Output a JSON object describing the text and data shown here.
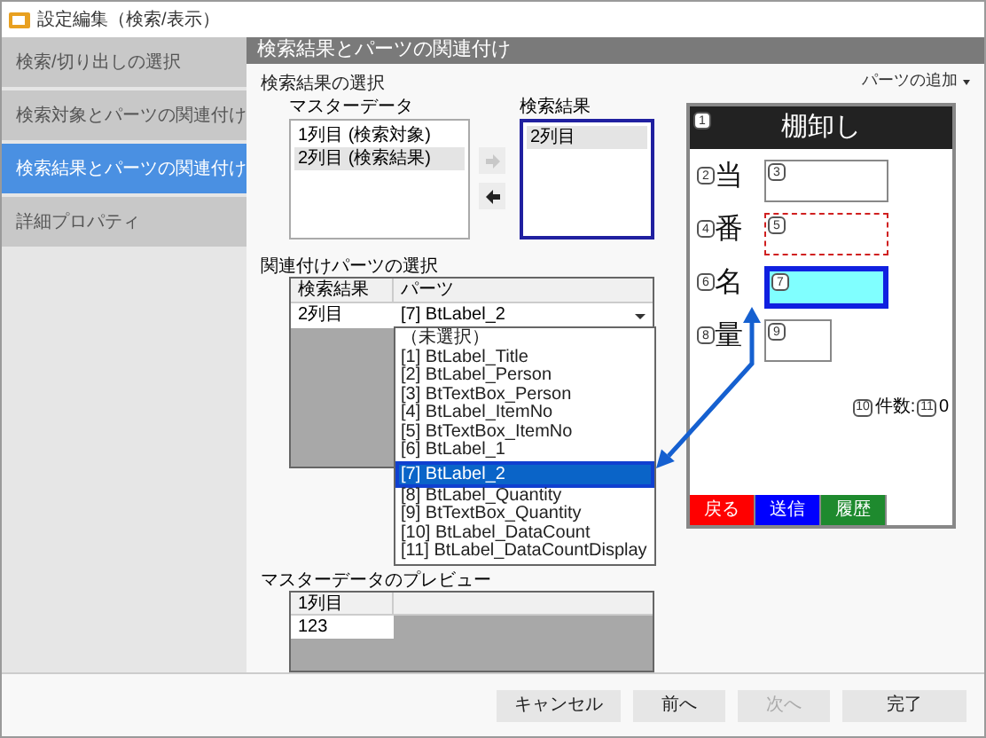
{
  "window": {
    "title": "設定編集（検索/表示）"
  },
  "sidebar": {
    "items": [
      {
        "label": "検索/切り出しの選択",
        "selected": false
      },
      {
        "label": "検索対象とパーツの関連付け",
        "selected": false
      },
      {
        "label": "検索結果とパーツの関連付け",
        "selected": true
      },
      {
        "label": "詳細プロパティ",
        "selected": false
      }
    ]
  },
  "page_title": "検索結果とパーツの関連付け",
  "result_selection": {
    "title": "検索結果の選択",
    "master": {
      "label": "マスターデータ",
      "items": [
        {
          "label": "1列目 (検索対象)",
          "selected": false
        },
        {
          "label": "2列目 (検索結果)",
          "selected": true
        }
      ]
    },
    "move_buttons": [
      {
        "kind": "right",
        "disabled": true
      },
      {
        "kind": "left",
        "disabled": false
      }
    ],
    "result": {
      "label": "検索結果",
      "focused": true,
      "items": [
        {
          "label": "2列目",
          "selected": true
        }
      ]
    }
  },
  "part_link": {
    "title": "関連付けパーツの選択",
    "columns": [
      "検索結果",
      "パーツ"
    ],
    "rows": [
      {
        "result": "2列目",
        "part": "[7] BtLabel_2"
      }
    ],
    "dropdown": {
      "items": [
        {
          "label": "（未選択）",
          "selected": false
        },
        {
          "label": "[1] BtLabel_Title",
          "selected": false
        },
        {
          "label": "[2] BtLabel_Person",
          "selected": false
        },
        {
          "label": "[3] BtTextBox_Person",
          "selected": false
        },
        {
          "label": "[4] BtLabel_ItemNo",
          "selected": false
        },
        {
          "label": "[5] BtTextBox_ItemNo",
          "selected": false
        },
        {
          "label": "[6] BtLabel_1",
          "selected": false
        },
        {
          "label": "[7] BtLabel_2",
          "selected": true
        },
        {
          "label": "[8] BtLabel_Quantity",
          "selected": false
        },
        {
          "label": "[9] BtTextBox_Quantity",
          "selected": false
        },
        {
          "label": "[10] BtLabel_DataCount",
          "selected": false
        },
        {
          "label": "[11] BtLabel_DataCountDisplay",
          "selected": false
        }
      ]
    }
  },
  "preview": {
    "title": "マスターデータのプレビュー",
    "columns": [
      "1列目"
    ],
    "rows": [
      [
        "123"
      ]
    ]
  },
  "form_preview": {
    "add_button": "パーツの追加",
    "title_badge": "1",
    "title": "棚卸し",
    "fields": [
      {
        "badge": "2",
        "label": "当",
        "box_badge": "3",
        "wide": true,
        "dashed": false,
        "selected": false
      },
      {
        "badge": "4",
        "label": "番",
        "box_badge": "5",
        "wide": true,
        "dashed": true,
        "selected": false
      },
      {
        "badge": "6",
        "label": "名",
        "box_badge": "7",
        "wide": true,
        "dashed": false,
        "selected": true
      },
      {
        "badge": "8",
        "label": "量",
        "box_badge": "9",
        "wide": false,
        "dashed": false,
        "selected": false
      }
    ],
    "count": {
      "badge": "10",
      "label": "件数:",
      "value_badge": "11",
      "value": "0"
    },
    "buttons": [
      {
        "label": "戻る",
        "color": "#ff0000"
      },
      {
        "label": "送信",
        "color": "#0000ff"
      },
      {
        "label": "履歴",
        "color": "#1e8a2e"
      }
    ]
  },
  "buttons": [
    {
      "label": "キャンセル",
      "disabled": false
    },
    {
      "label": "前へ",
      "disabled": false
    },
    {
      "label": "次へ",
      "disabled": true
    },
    {
      "label": "完了",
      "disabled": false
    }
  ]
}
